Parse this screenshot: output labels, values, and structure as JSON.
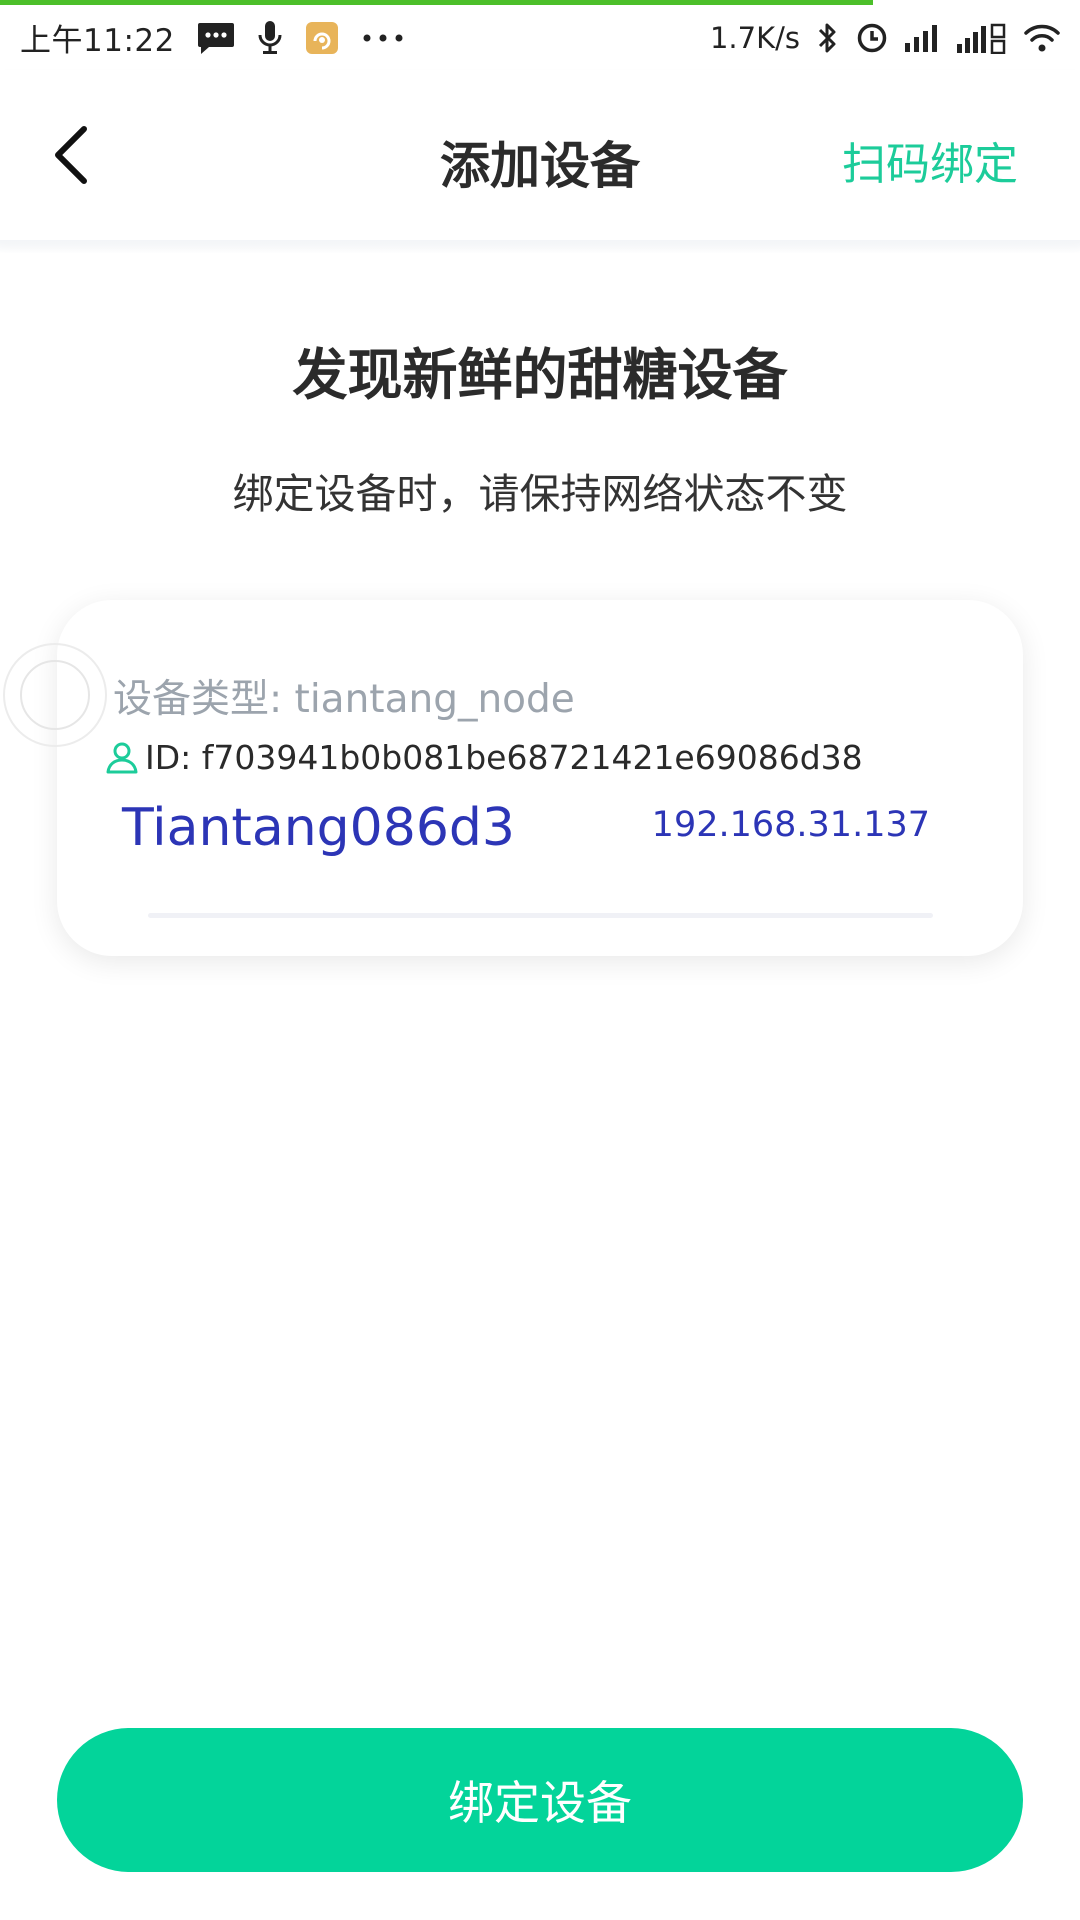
{
  "status_bar": {
    "time": "上午11:22",
    "speed": "1.7K/s",
    "icons_left": [
      "message-icon",
      "microphone-icon",
      "app-notification-icon",
      "more-dots-icon"
    ],
    "icons_right": [
      "bluetooth-icon",
      "alarm-icon",
      "signal-icon",
      "signal-4g-icon",
      "wifi-icon"
    ]
  },
  "header": {
    "title": "添加设备",
    "action_label": "扫码绑定",
    "back_icon": "chevron-left-icon"
  },
  "main": {
    "heading": "发现新鲜的甜糖设备",
    "subheading": "绑定设备时，请保持网络状态不变"
  },
  "device": {
    "type_label": "设备类型: tiantang_node",
    "id_label": "ID: f703941b0b081be68721421e69086d38",
    "name": "Tiantang086d3",
    "ip": "192.168.31.137",
    "id_icon": "user-icon"
  },
  "footer": {
    "bind_label": "绑定设备"
  },
  "colors": {
    "accent": "#03d49a",
    "link_green": "#1ccc9a",
    "device_blue": "#2c35b6",
    "muted_gray": "#9ca4ad",
    "progress_green": "#4cbf2a"
  }
}
